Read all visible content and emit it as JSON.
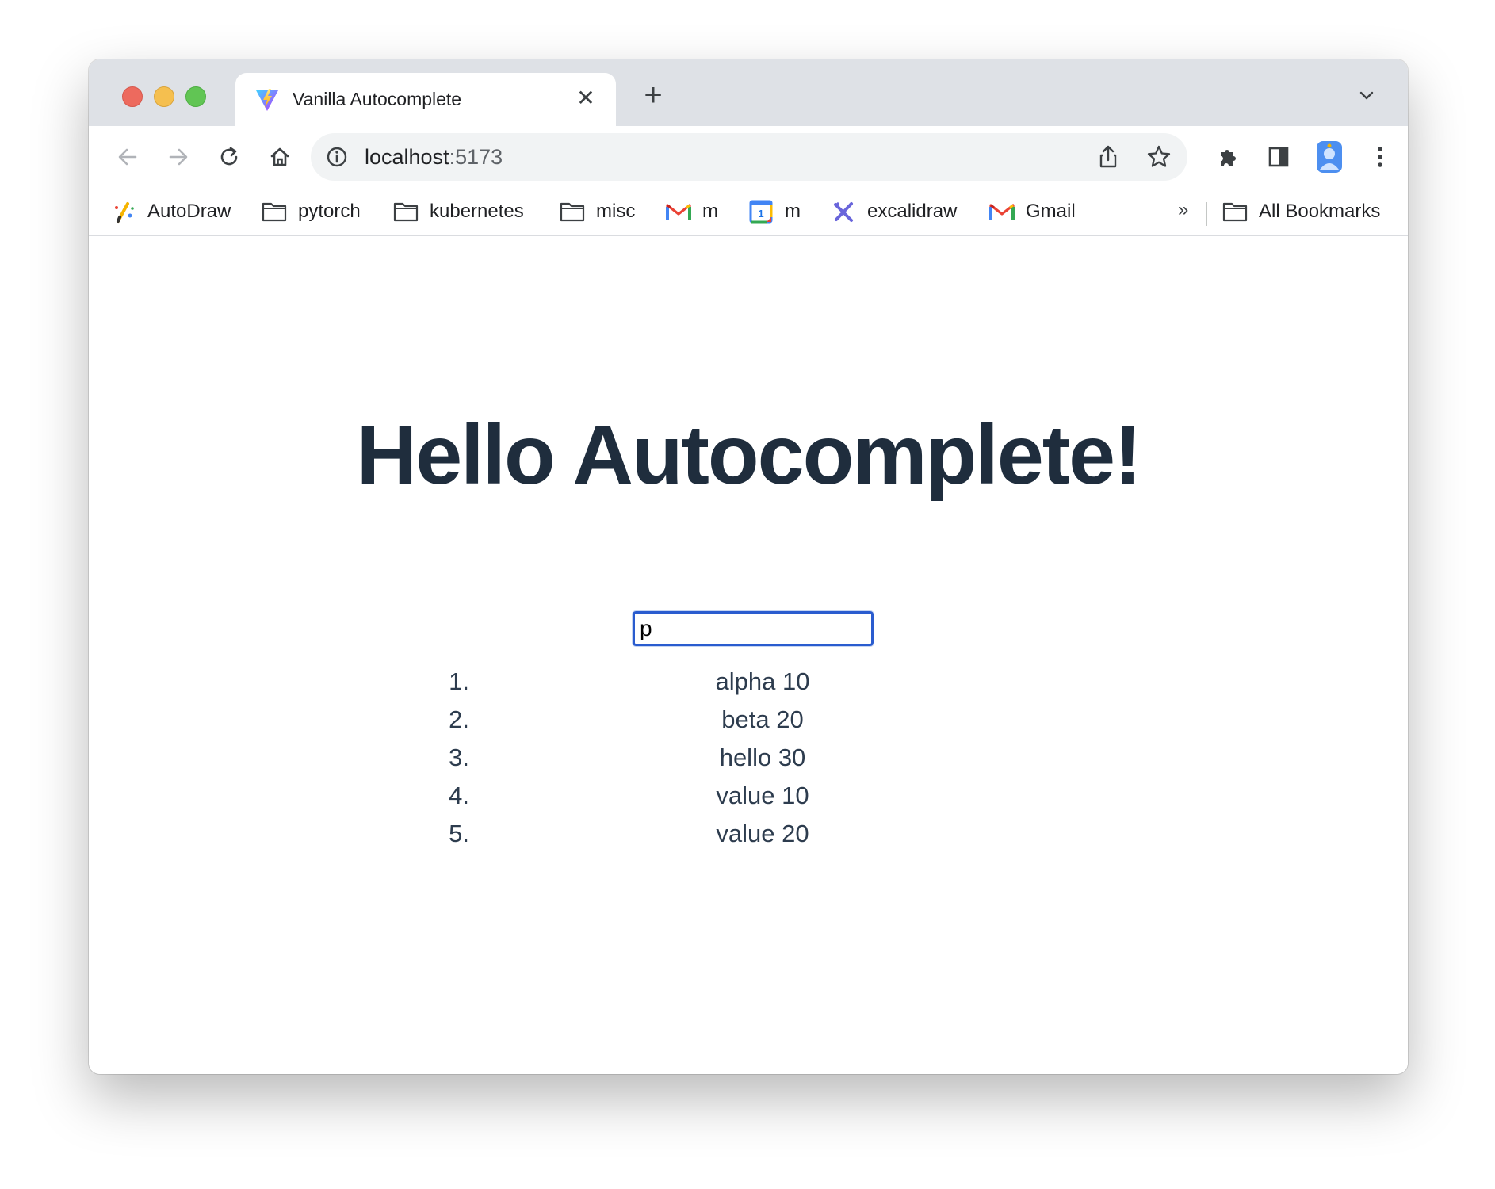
{
  "browser": {
    "tab": {
      "title": "Vanilla Autocomplete",
      "favicon": "vite-logo-icon",
      "close_label": "✕"
    },
    "new_tab_label": "+",
    "address_bar": {
      "host": "localhost",
      "port": ":5173"
    },
    "bookmarks": [
      {
        "label": "AutoDraw",
        "icon": "autodraw-icon"
      },
      {
        "label": "pytorch",
        "icon": "folder-icon"
      },
      {
        "label": "kubernetes",
        "icon": "folder-icon"
      },
      {
        "label": "misc",
        "icon": "folder-icon"
      },
      {
        "label": "m",
        "icon": "gmail-icon"
      },
      {
        "label": "m",
        "icon": "google-calendar-icon"
      },
      {
        "label": "excalidraw",
        "icon": "excalidraw-icon"
      },
      {
        "label": "Gmail",
        "icon": "gmail-icon"
      }
    ],
    "bookmarks_overflow": "»",
    "all_bookmarks_label": "All Bookmarks"
  },
  "page": {
    "heading": "Hello Autocomplete!",
    "search": {
      "value": "p",
      "placeholder": ""
    },
    "results": [
      {
        "number": "1.",
        "text": "alpha 10"
      },
      {
        "number": "2.",
        "text": "beta 20"
      },
      {
        "number": "3.",
        "text": "hello 30"
      },
      {
        "number": "4.",
        "text": "value 10"
      },
      {
        "number": "5.",
        "text": "value 20"
      }
    ]
  },
  "colors": {
    "heading": "#1f2d3d",
    "input_focus_border": "#2a5ccf",
    "tabstrip": "#dee1e6",
    "omnibox": "#f1f3f4"
  }
}
